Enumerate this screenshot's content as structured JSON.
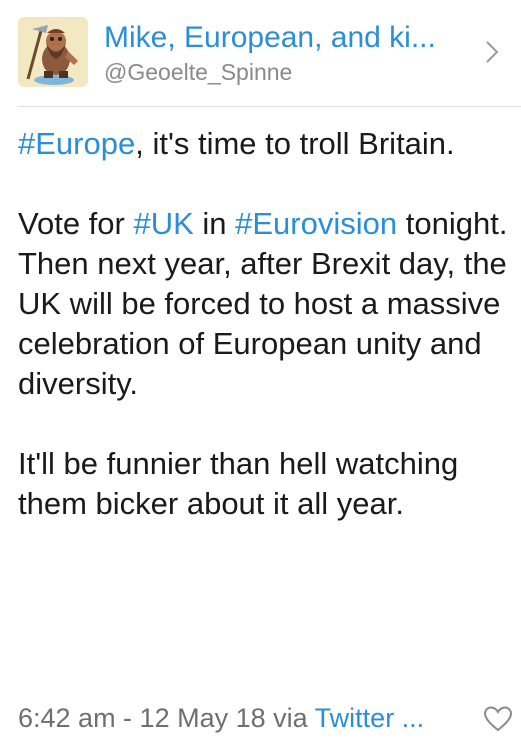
{
  "header": {
    "display_name": "Mike, European, and ki...",
    "handle": "@Geoelte_Spinne",
    "avatar_icon": "cartoon-dwarf-avatar",
    "chevron_icon": "chevron-right-icon"
  },
  "tweet": {
    "p1": {
      "tag": "#Europe",
      "text": ", it's time to troll Britain."
    },
    "p2": {
      "pre": "Vote for ",
      "tag1": "#UK",
      "mid": " in ",
      "tag2": "#Eurovision",
      "post": " tonight. Then next year, after Brexit day, the UK will be forced to host a massive celebration of European unity and diversity."
    },
    "p3": "It'll be funnier than hell watching them bicker about it all year."
  },
  "footer": {
    "timestamp": "6:42 am - 12 May 18 via ",
    "source": "Twitter ...",
    "like_icon": "heart-outline-icon"
  },
  "colors": {
    "link": "#2a8ed8",
    "text": "#1a1a1a",
    "muted": "#8a8a8a",
    "divider": "#dedede"
  }
}
